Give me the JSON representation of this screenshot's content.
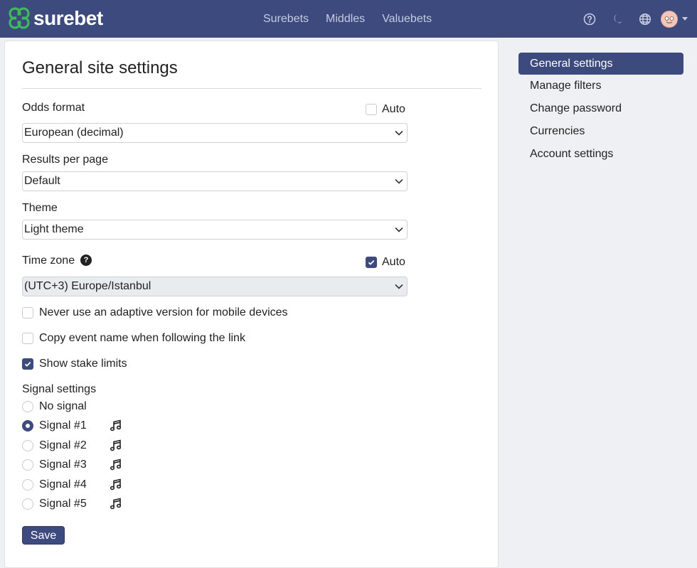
{
  "header": {
    "logo_text": "surebet",
    "nav": [
      {
        "label": "Surebets"
      },
      {
        "label": "Middles"
      },
      {
        "label": "Valuebets"
      }
    ],
    "icons": [
      "help-icon",
      "moon-icon",
      "globe-icon",
      "avatar",
      "chevron-down-icon"
    ]
  },
  "page": {
    "title": "General site settings"
  },
  "odds": {
    "label": "Odds format",
    "auto_label": "Auto",
    "auto_checked": false,
    "value": "European (decimal)"
  },
  "results": {
    "label": "Results per page",
    "value": "Default"
  },
  "theme": {
    "label": "Theme",
    "value": "Light theme"
  },
  "timezone": {
    "label": "Time zone",
    "help": "?",
    "auto_label": "Auto",
    "auto_checked": true,
    "value": "(UTC+3) Europe/Istanbul"
  },
  "options": [
    {
      "label": "Never use an adaptive version for mobile devices",
      "checked": false
    },
    {
      "label": "Copy event name when following the link",
      "checked": false
    },
    {
      "label": "Show stake limits",
      "checked": true
    }
  ],
  "signal": {
    "heading": "Signal settings",
    "items": [
      {
        "label": "No signal",
        "selected": false,
        "icon": ""
      },
      {
        "label": "Signal #1",
        "selected": true,
        "icon": "music-note-icon"
      },
      {
        "label": "Signal #2",
        "selected": false,
        "icon": "music-note-icon"
      },
      {
        "label": "Signal #3",
        "selected": false,
        "icon": "music-note-icon"
      },
      {
        "label": "Signal #4",
        "selected": false,
        "icon": "music-note-icon"
      },
      {
        "label": "Signal #5",
        "selected": false,
        "icon": "music-note-icon"
      }
    ]
  },
  "save_label": "Save",
  "sidebar": {
    "items": [
      {
        "label": "General settings",
        "active": true
      },
      {
        "label": "Manage filters",
        "active": false
      },
      {
        "label": "Change password",
        "active": false
      },
      {
        "label": "Currencies",
        "active": false
      },
      {
        "label": "Account settings",
        "active": false
      }
    ]
  },
  "colors": {
    "header_bg": "#3c4a7d",
    "accent": "#3c4a7d",
    "logo_green": "#3dbb5a"
  }
}
